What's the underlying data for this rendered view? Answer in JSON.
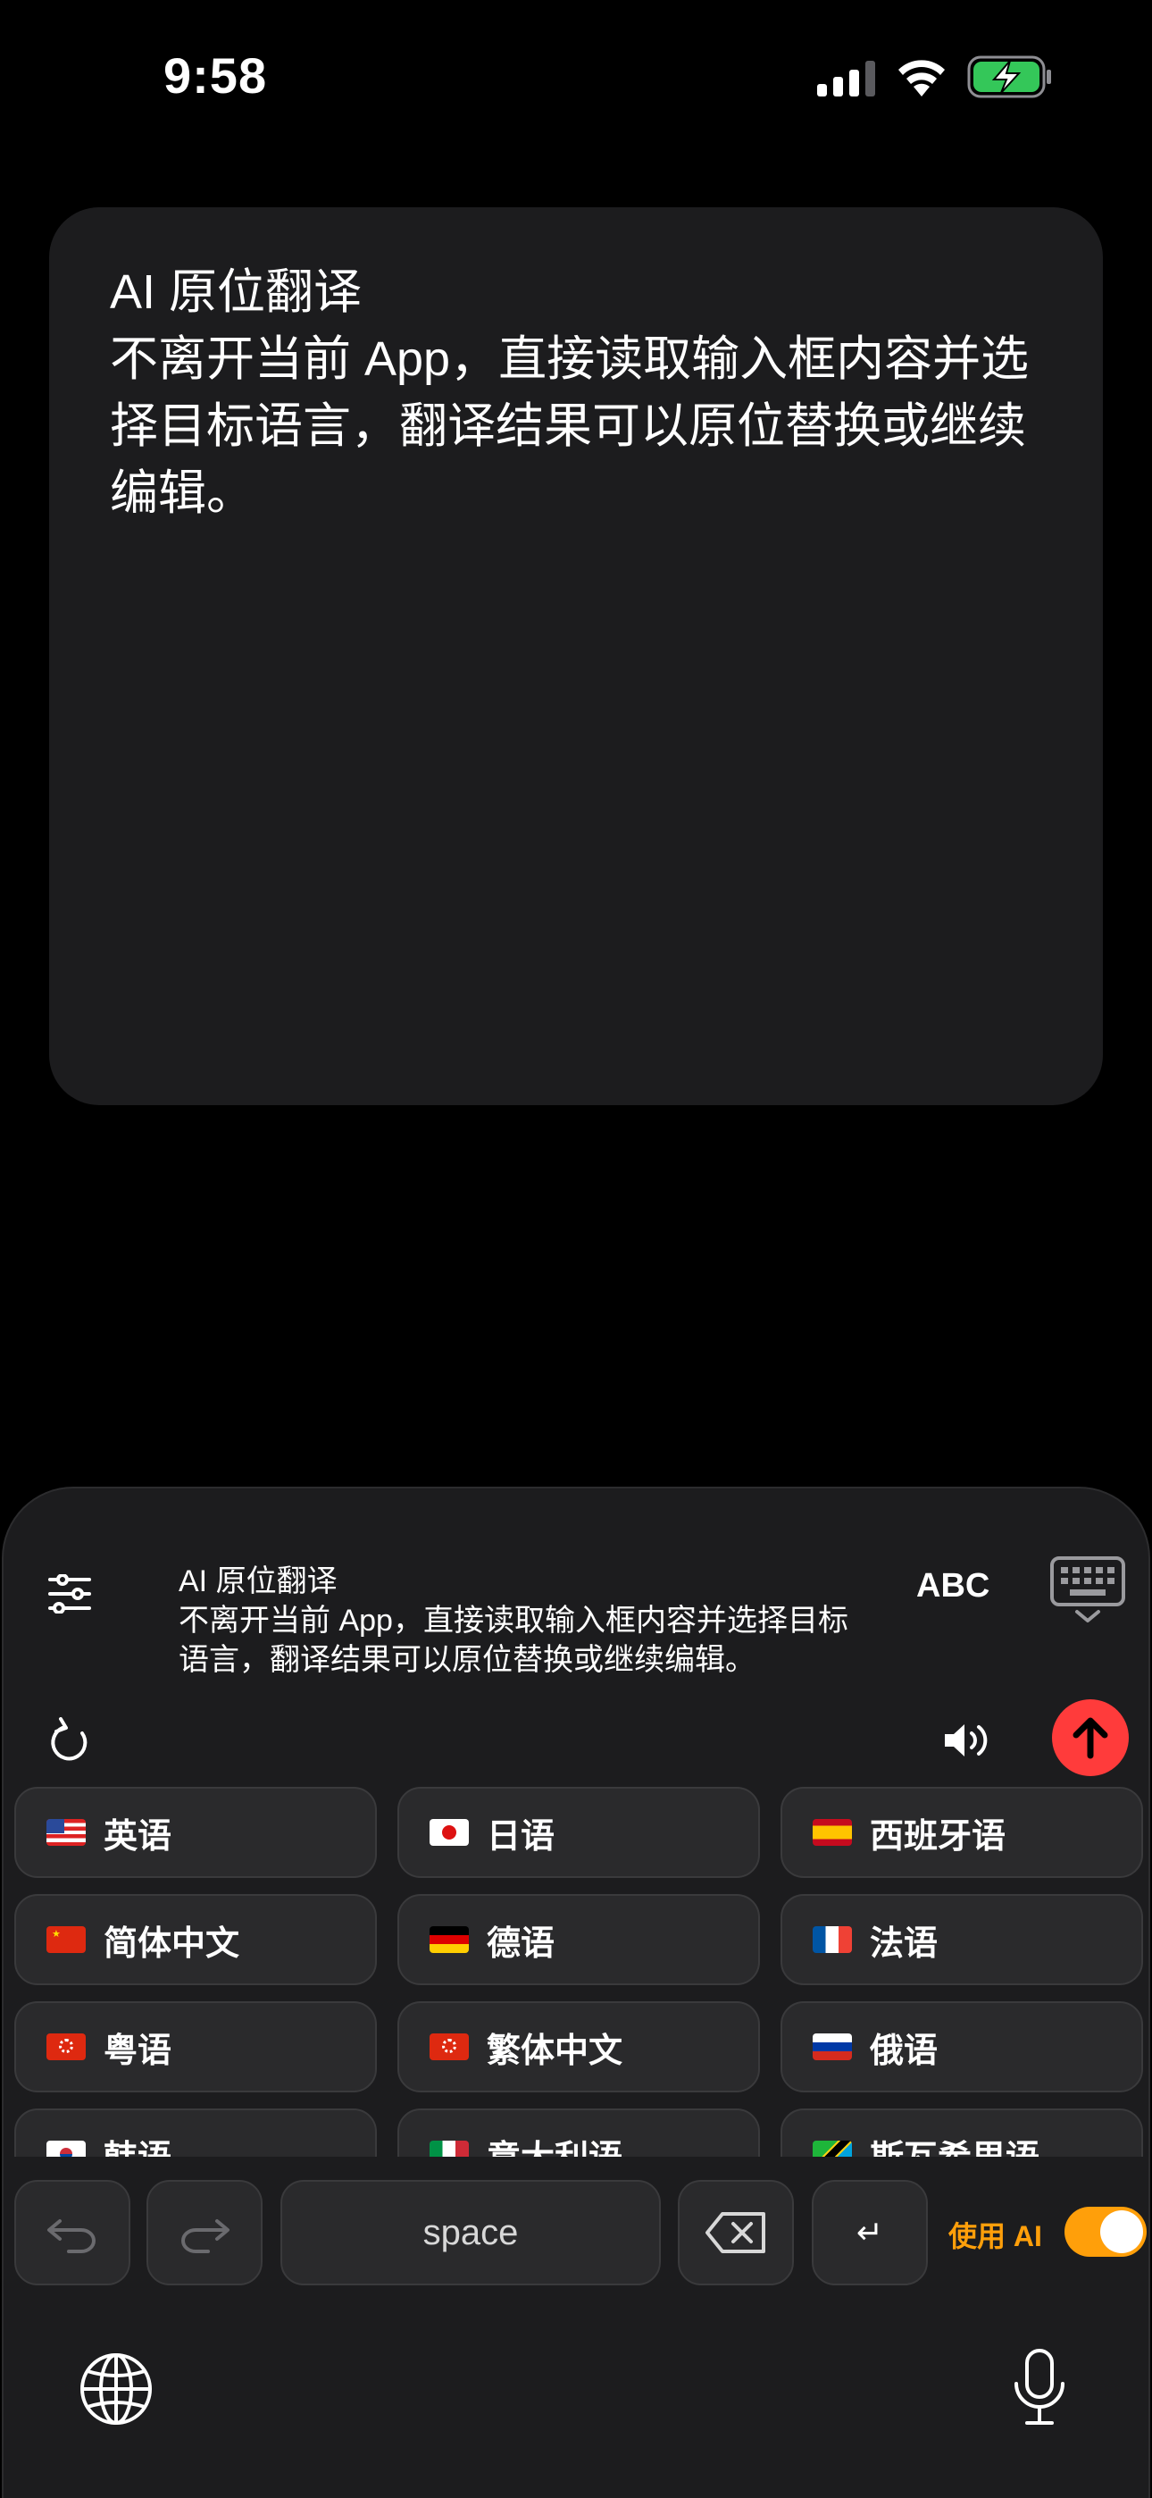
{
  "status_bar": {
    "time": "9:58"
  },
  "editor": {
    "text": "AI 原位翻译\n不离开当前 App，直接读取输入框内容并选择目标语言，翻译结果可以原位替换或继续编辑。"
  },
  "keyboard": {
    "preview_text": "AI 原位翻译\n不离开当前 App，直接读取输入框内容并选择目标语言，翻译结果可以原位替换或继续编辑。",
    "abc_label": "ABC",
    "space_label": "space",
    "return_label": "↵",
    "ai_toggle_label": "使用 AI",
    "ai_toggle_on": true,
    "accent_color": "#ff9f0a",
    "send_color": "#ff3b3b",
    "languages": [
      {
        "flag": "us-flag",
        "label": "英语"
      },
      {
        "flag": "jp-flag",
        "label": "日语"
      },
      {
        "flag": "es-flag",
        "label": "西班牙语"
      },
      {
        "flag": "cn-flag",
        "label": "简体中文"
      },
      {
        "flag": "de-flag",
        "label": "德语"
      },
      {
        "flag": "fr-flag",
        "label": "法语"
      },
      {
        "flag": "hk-flag",
        "label": "粤语"
      },
      {
        "flag": "hk-flag",
        "label": "繁体中文"
      },
      {
        "flag": "ru-flag",
        "label": "俄语"
      },
      {
        "flag": "kr-flag",
        "label": "韩语"
      },
      {
        "flag": "it-flag",
        "label": "意大利语"
      },
      {
        "flag": "tz-flag",
        "label": "斯瓦希里语"
      }
    ]
  }
}
